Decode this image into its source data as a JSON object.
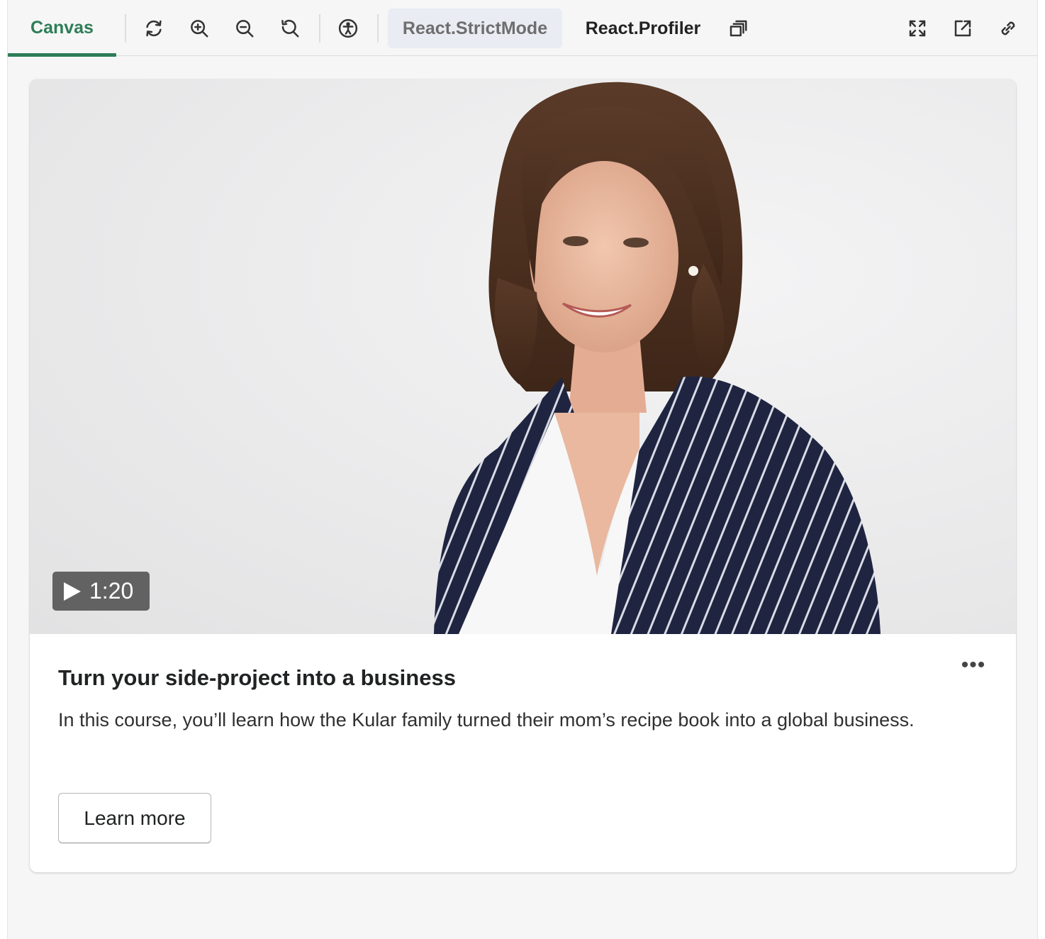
{
  "toolbar": {
    "active_tab": "Canvas",
    "icons": [
      "reload-icon",
      "zoom-in-icon",
      "zoom-out-icon",
      "zoom-reset-icon",
      "accessibility-icon",
      "outline-icon",
      "fullscreen-icon",
      "open-new-tab-icon",
      "copy-link-icon"
    ],
    "strict_mode_label": "React.StrictMode",
    "profiler_label": "React.Profiler"
  },
  "card": {
    "duration": "1:20",
    "title": "Turn your side-project into a business",
    "description": "In this course, you’ll learn how the Kular family turned their mom’s recipe book into a global business.",
    "more_label": "•••",
    "button_label": "Learn more"
  },
  "colors": {
    "accent": "#2e7d57",
    "badge_bg": "#505050",
    "strict_pill_bg": "#e9ecf2"
  }
}
